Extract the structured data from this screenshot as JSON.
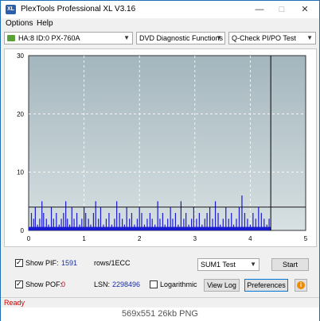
{
  "window": {
    "title": "PlexTools Professional XL V3.16",
    "icon_letters": "XL"
  },
  "menu": {
    "options_label": "Options",
    "help_label": "Help"
  },
  "toolbar": {
    "drive": "HA:8 ID:0  PX-760A",
    "function": "DVD Diagnostic Functions",
    "test": "Q-Check PI/PO Test"
  },
  "chart_data": {
    "type": "bar",
    "x_ticks": [
      "0",
      "1",
      "2",
      "3",
      "4",
      "5"
    ],
    "y_ticks": [
      "0",
      "10",
      "20",
      "30"
    ],
    "xlim": [
      0,
      5
    ],
    "ylim": [
      0,
      30
    ],
    "grid": true,
    "threshold_line": 4,
    "end_marker_x": 4.37,
    "plot_background": [
      "#a3b6bd",
      "#d7e0e2"
    ],
    "bar_color": "#1a1ad0",
    "series": [
      {
        "x": [
          0.05,
          0.09,
          0.12,
          0.16,
          0.2,
          0.24,
          0.27,
          0.32,
          0.36,
          0.41,
          0.45,
          0.5,
          0.55,
          0.59,
          0.63,
          0.67,
          0.7,
          0.74,
          0.78,
          0.82,
          0.87,
          0.92,
          0.96,
          1.0,
          1.03,
          1.08,
          1.12,
          1.17,
          1.21,
          1.26,
          1.3,
          1.35,
          1.4,
          1.45,
          1.5,
          1.55,
          1.59,
          1.64,
          1.69,
          1.73,
          1.77,
          1.82,
          1.86,
          1.91,
          1.96,
          2.0,
          2.04,
          2.09,
          2.14,
          2.19,
          2.23,
          2.28,
          2.33,
          2.37,
          2.42,
          2.46,
          2.51,
          2.56,
          2.6,
          2.65,
          2.7,
          2.75,
          2.8,
          2.84,
          2.89,
          2.94,
          2.98,
          3.03,
          3.08,
          3.13,
          3.18,
          3.22,
          3.27,
          3.32,
          3.37,
          3.42,
          3.46,
          3.51,
          3.56,
          3.61,
          3.66,
          3.7,
          3.75,
          3.8,
          3.85,
          3.9,
          3.95,
          4.0,
          4.05,
          4.1,
          4.15,
          4.2,
          4.25,
          4.3,
          4.34
        ],
        "values": [
          3,
          2,
          4,
          1,
          2,
          5,
          3,
          2,
          1,
          4,
          2,
          3,
          1,
          2,
          3,
          5,
          2,
          1,
          4,
          2,
          3,
          1,
          2,
          4,
          3,
          2,
          1,
          3,
          5,
          2,
          4,
          1,
          2,
          3,
          1,
          2,
          5,
          3,
          2,
          1,
          4,
          2,
          3,
          1,
          2,
          4,
          3,
          1,
          2,
          3,
          2,
          1,
          5,
          2,
          3,
          1,
          2,
          4,
          2,
          3,
          1,
          5,
          2,
          3,
          1,
          2,
          4,
          2,
          3,
          1,
          2,
          3,
          4,
          2,
          5,
          3,
          1,
          2,
          4,
          2,
          3,
          1,
          2,
          4,
          6,
          3,
          2,
          1,
          3,
          2,
          4,
          3,
          2,
          1,
          2
        ]
      }
    ]
  },
  "controls": {
    "show_pif_label": "Show PIF:",
    "pif_value": "1591",
    "pif_unit": "rows/1ECC",
    "show_pof_label": "Show POF:",
    "pof_value": "0",
    "lsn_label": "LSN:",
    "lsn_value": "2298496",
    "logarithmic_label": "Logarithmic",
    "sum_select": "SUM1 Test",
    "start_label": "Start",
    "view_log_label": "View Log",
    "preferences_label": "Preferences",
    "info_icon_glyph": "i"
  },
  "status": {
    "text": "Ready"
  },
  "caption": {
    "text": "569x551  26kb  PNG"
  }
}
